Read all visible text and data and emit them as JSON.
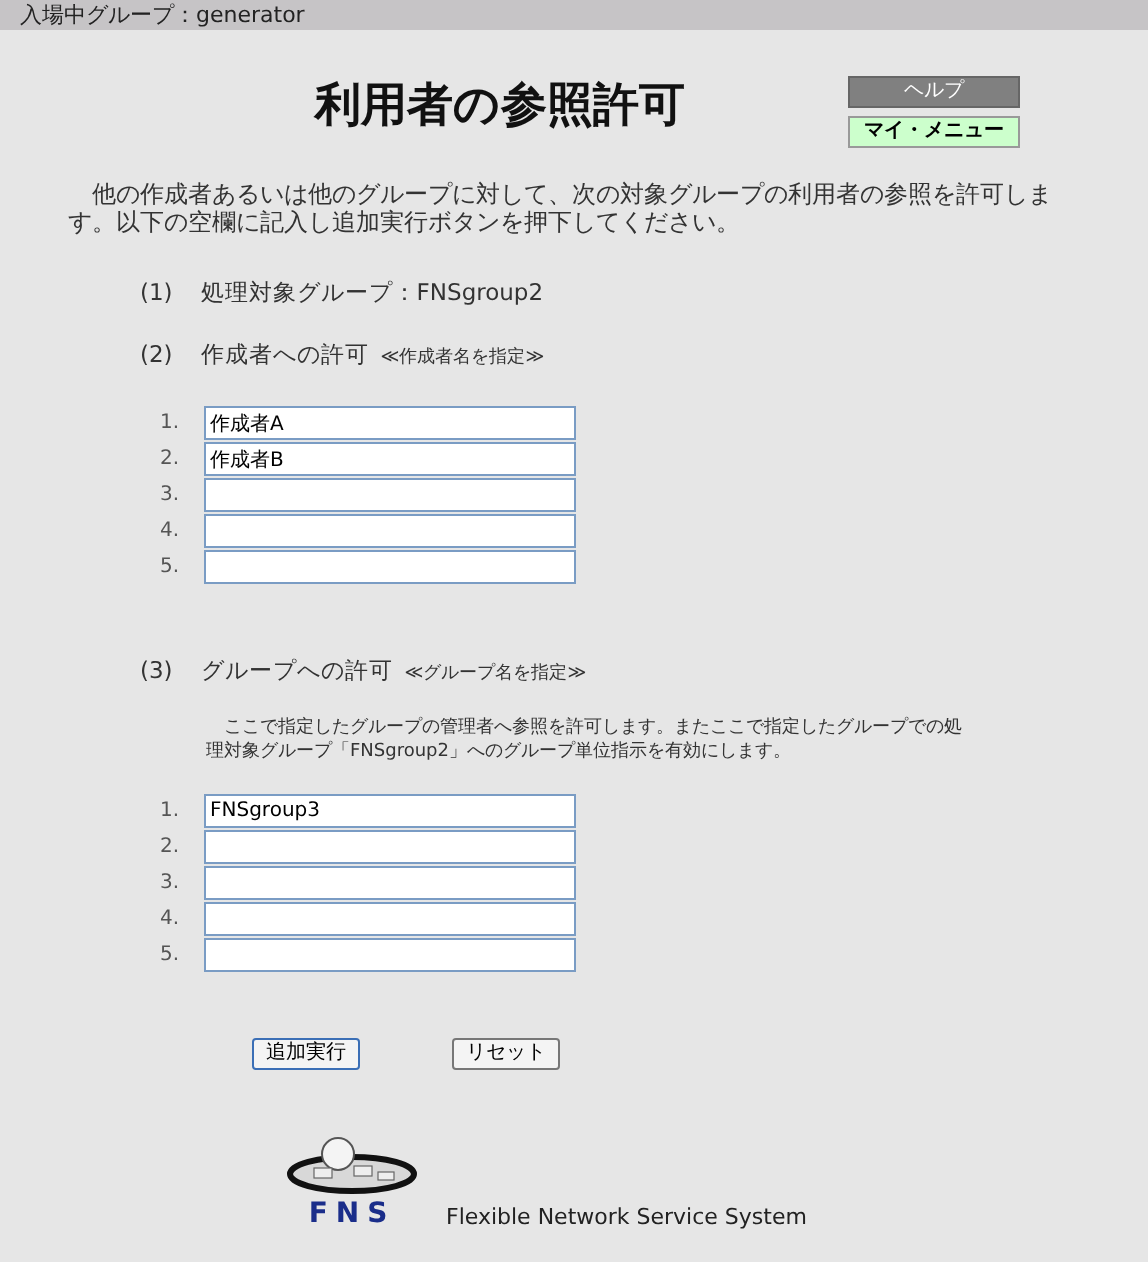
{
  "header": {
    "group_label": "入場中グループ：generator"
  },
  "title": "利用者の参照許可",
  "menu_buttons": [
    {
      "label": "ヘルプ",
      "kind": "dark"
    },
    {
      "label": "マイ・メニュー",
      "kind": "light"
    }
  ],
  "intro": "他の作成者あるいは他のグループに対して、次の対象グループの利用者の参照を許可します。以下の空欄に記入し追加実行ボタンを押下してください。",
  "sections": [
    {
      "kind": "info",
      "number": "(1)",
      "label": "処理対象グループ：FNSgroup2"
    },
    {
      "kind": "fields",
      "number": "(2)",
      "label": "作成者への許可",
      "hint": "≪作成者名を指定≫",
      "fields": [
        {
          "number": "1.",
          "value": "作成者A"
        },
        {
          "number": "2.",
          "value": "作成者B"
        },
        {
          "number": "3."
        },
        {
          "number": "4."
        },
        {
          "number": "5."
        }
      ]
    },
    {
      "kind": "fields",
      "number": "(3)",
      "label": "グループへの許可",
      "hint": "≪グループ名を指定≫",
      "note": "ここで指定したグループの管理者へ参照を許可します。またここで指定したグループでの処理対象グループ「FNSgroup2」へのグループ単位指示を有効にします。",
      "fields": [
        {
          "number": "1.",
          "value": "FNSgroup3"
        },
        {
          "number": "2."
        },
        {
          "number": "3."
        },
        {
          "number": "4."
        },
        {
          "number": "5."
        }
      ]
    }
  ],
  "actions": [
    "追加実行",
    "リセット"
  ],
  "footer": {
    "logo_text": "FNS",
    "system_name": "Flexible Network Service System"
  }
}
